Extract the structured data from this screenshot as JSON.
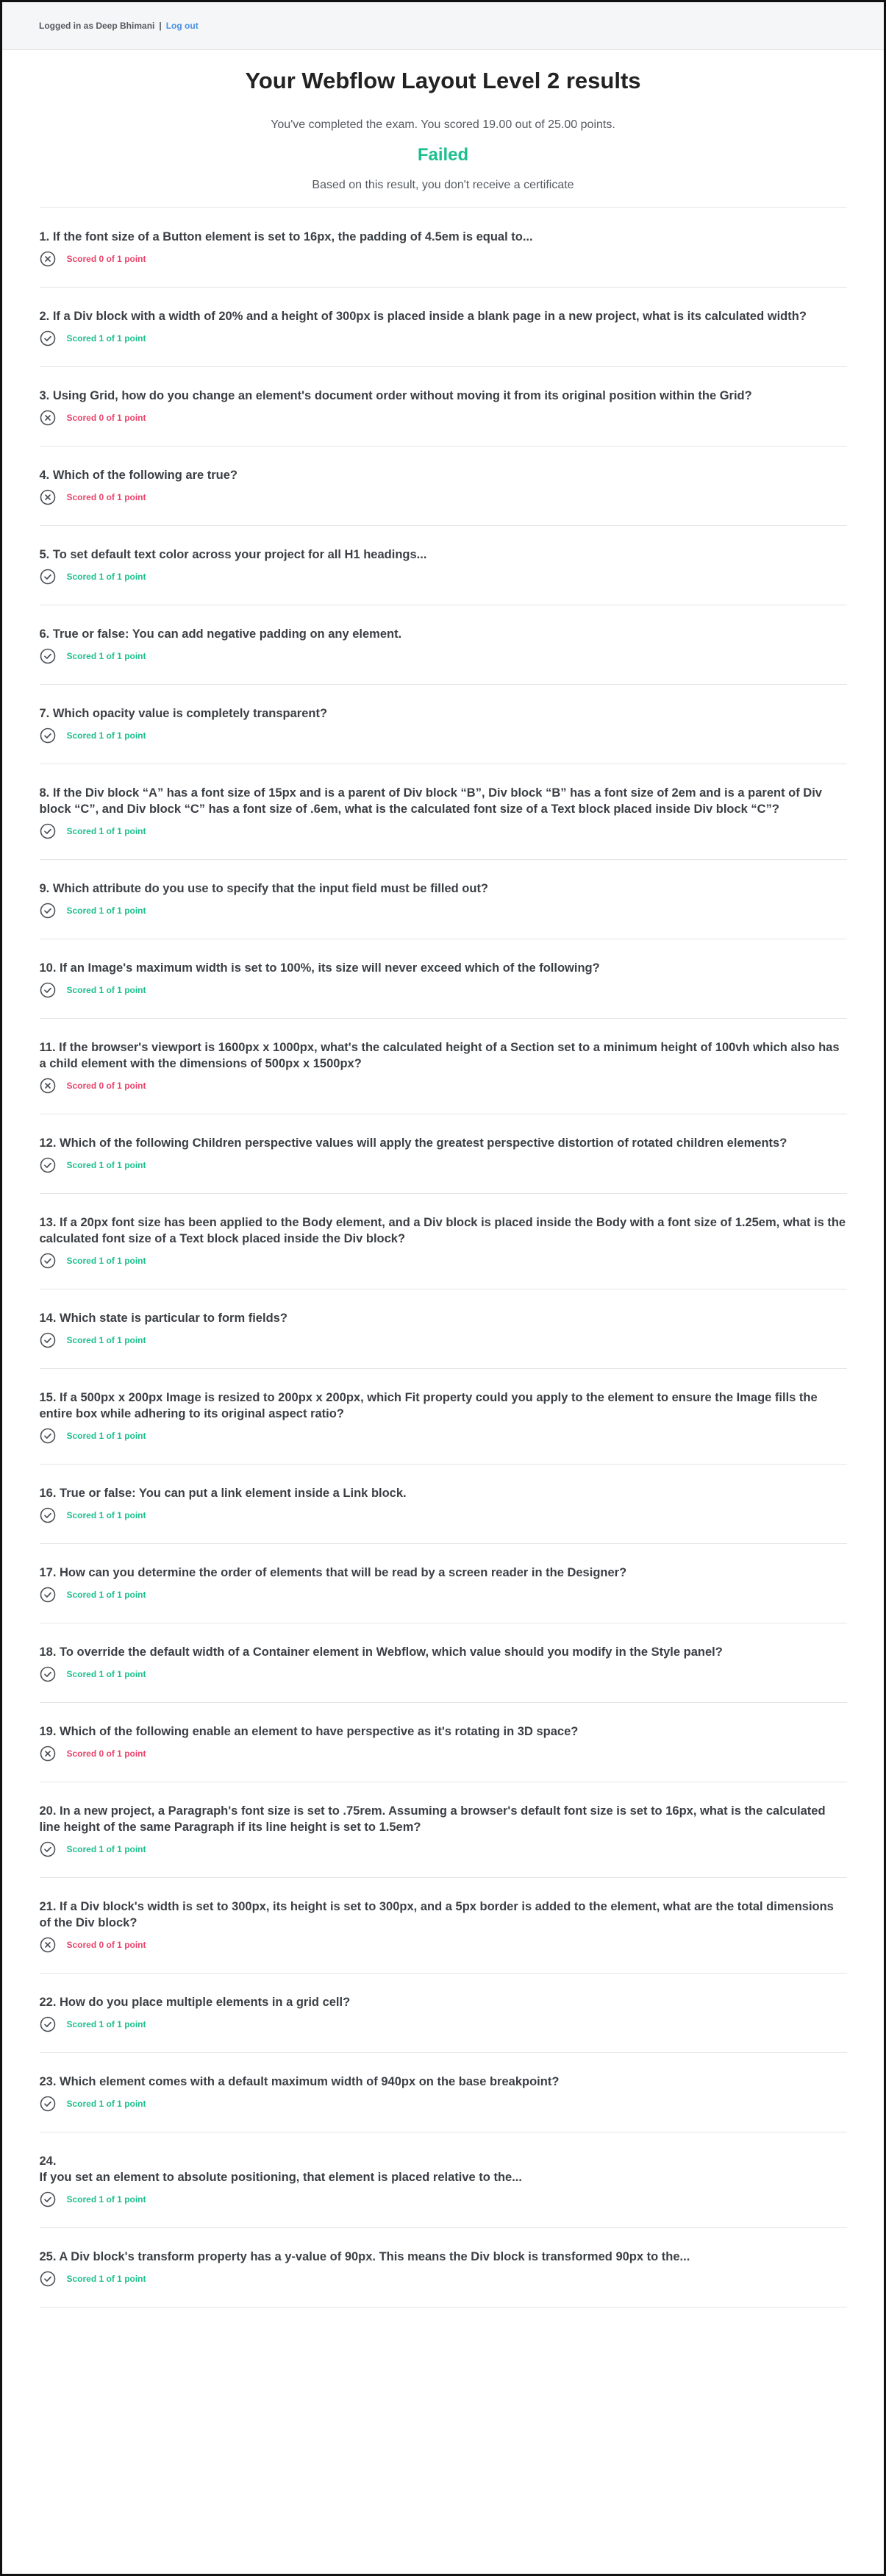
{
  "topbar": {
    "logged_in": "Logged in as Deep Bhimani",
    "separator": "|",
    "logout": "Log out"
  },
  "header": {
    "title": "Your Webflow Layout Level 2 results",
    "score_text": "You've completed the exam. You scored 19.00 out of 25.00 points.",
    "status": "Failed",
    "certificate_text": "Based on this result, you don't receive a certificate"
  },
  "colors": {
    "pass": "#1dbf8e",
    "fail": "#e8446b",
    "link": "#4a90e2"
  },
  "icons": {
    "pass": "check-circle-icon",
    "fail": "x-circle-icon"
  },
  "questions": [
    {
      "text": "1. If the font size of a Button element is set to 16px, the padding of 4.5em is equal to...",
      "result": "Scored 0 of 1 point",
      "passed": false
    },
    {
      "text": "2. If a Div block with a width of 20% and a height of 300px is placed inside a blank page in a new project, what is its calculated width?",
      "result": "Scored 1 of 1 point",
      "passed": true
    },
    {
      "text": "3. Using Grid, how do you change an element's document order without moving it from its original position within the Grid?",
      "result": "Scored 0 of 1 point",
      "passed": false
    },
    {
      "text": "4. Which of the following are true?",
      "result": "Scored 0 of 1 point",
      "passed": false
    },
    {
      "text": "5. To set default text color across your project for all H1 headings...",
      "result": "Scored 1 of 1 point",
      "passed": true
    },
    {
      "text": "6. True or false: You can add negative padding on any element.",
      "result": "Scored 1 of 1 point",
      "passed": true
    },
    {
      "text": "7. Which opacity value is completely transparent?",
      "result": "Scored 1 of 1 point",
      "passed": true
    },
    {
      "text": "8. If the Div block “A” has a font size of 15px and is a parent of Div block “B”, Div block “B” has a font size of 2em and is a parent of Div block “C”, and Div block “C” has a font size of .6em, what is the calculated font size of a Text block placed inside Div block “C”?",
      "result": "Scored 1 of 1 point",
      "passed": true
    },
    {
      "text": "9. Which attribute do you use to specify that the input field must be filled out?",
      "result": "Scored 1 of 1 point",
      "passed": true
    },
    {
      "text": "10. If an Image's maximum width is set to 100%, its size will never exceed which of the following?",
      "result": "Scored 1 of 1 point",
      "passed": true
    },
    {
      "text": "11. If the browser's viewport is 1600px x 1000px, what's the calculated height of a Section set to a minimum height of 100vh which also has a child element with the dimensions of 500px x 1500px?",
      "result": "Scored 0 of 1 point",
      "passed": false
    },
    {
      "text": "12. Which of the following Children perspective values will apply the greatest perspective distortion of rotated children elements?",
      "result": "Scored 1 of 1 point",
      "passed": true
    },
    {
      "text": "13. If a 20px font size has been applied to the Body element, and a Div block is placed inside the Body with a font size of 1.25em, what is the calculated font size of a Text block placed inside the Div block?",
      "result": "Scored 1 of 1 point",
      "passed": true
    },
    {
      "text": "14. Which state is particular to form fields?",
      "result": "Scored 1 of 1 point",
      "passed": true
    },
    {
      "text": "15. If a 500px x 200px Image is resized to 200px x 200px, which Fit property could you apply to the element to ensure the Image fills the entire box while adhering to its original aspect ratio?",
      "result": "Scored 1 of 1 point",
      "passed": true
    },
    {
      "text": "16. True or false: You can put a link element inside a Link block.",
      "result": "Scored 1 of 1 point",
      "passed": true
    },
    {
      "text": "17. How can you determine the order of elements that will be read by a screen reader in the Designer?",
      "result": "Scored 1 of 1 point",
      "passed": true
    },
    {
      "text": "18. To override the default width of a Container element in Webflow, which value should you modify in the Style panel?",
      "result": "Scored 1 of 1 point",
      "passed": true
    },
    {
      "text": "19. Which of the following enable an element to have perspective as it's rotating in 3D space?",
      "result": "Scored 0 of 1 point",
      "passed": false
    },
    {
      "text": "20. In a new project, a Paragraph's font size is set to .75rem. Assuming a browser's default font size is set to 16px, what is the calculated line height of the same Paragraph if its line height is set to 1.5em?",
      "result": "Scored 1 of 1 point",
      "passed": true
    },
    {
      "text": "21. If a Div block's width is set to 300px, its height is set to 300px, and a 5px border is added to the element, what are the total dimensions of the Div block?",
      "result": "Scored 0 of 1 point",
      "passed": false
    },
    {
      "text": "22. How do you place multiple elements in a grid cell?",
      "result": "Scored 1 of 1 point",
      "passed": true
    },
    {
      "text": "23. Which element comes with a default maximum width of 940px on the base breakpoint?",
      "result": "Scored 1 of 1 point",
      "passed": true
    },
    {
      "number": "24.",
      "text": "If you set an element to absolute positioning, that element is placed relative to the...",
      "result": "Scored 1 of 1 point",
      "passed": true
    },
    {
      "text": "25. A Div block's transform property has a y-value of 90px. This means the Div block is transformed 90px to the...",
      "result": "Scored 1 of 1 point",
      "passed": true
    }
  ]
}
